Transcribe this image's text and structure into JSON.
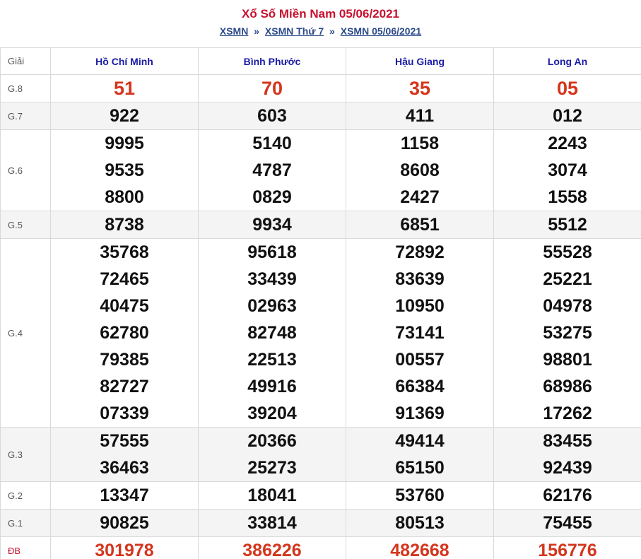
{
  "header": {
    "title": "Xổ Số Miền Nam 05/06/2021",
    "breadcrumb": [
      "XSMN",
      "XSMN Thứ 7",
      "XSMN 05/06/2021"
    ],
    "separator": "»"
  },
  "table": {
    "label_header": "Giải",
    "provinces": [
      "Hồ Chí Minh",
      "Bình Phước",
      "Hậu Giang",
      "Long An"
    ],
    "rows": [
      {
        "label": "G.8",
        "values": [
          [
            "51"
          ],
          [
            "70"
          ],
          [
            "35"
          ],
          [
            "05"
          ]
        ]
      },
      {
        "label": "G.7",
        "values": [
          [
            "922"
          ],
          [
            "603"
          ],
          [
            "411"
          ],
          [
            "012"
          ]
        ]
      },
      {
        "label": "G.6",
        "values": [
          [
            "9995",
            "9535",
            "8800"
          ],
          [
            "5140",
            "4787",
            "0829"
          ],
          [
            "1158",
            "8608",
            "2427"
          ],
          [
            "2243",
            "3074",
            "1558"
          ]
        ]
      },
      {
        "label": "G.5",
        "values": [
          [
            "8738"
          ],
          [
            "9934"
          ],
          [
            "6851"
          ],
          [
            "5512"
          ]
        ]
      },
      {
        "label": "G.4",
        "values": [
          [
            "35768",
            "72465",
            "40475",
            "62780",
            "79385",
            "82727",
            "07339"
          ],
          [
            "95618",
            "33439",
            "02963",
            "82748",
            "22513",
            "49916",
            "39204"
          ],
          [
            "72892",
            "83639",
            "10950",
            "73141",
            "00557",
            "66384",
            "91369"
          ],
          [
            "55528",
            "25221",
            "04978",
            "53275",
            "98801",
            "68986",
            "17262"
          ]
        ]
      },
      {
        "label": "G.3",
        "values": [
          [
            "57555",
            "36463"
          ],
          [
            "20366",
            "25273"
          ],
          [
            "49414",
            "65150"
          ],
          [
            "83455",
            "92439"
          ]
        ]
      },
      {
        "label": "G.2",
        "values": [
          [
            "13347"
          ],
          [
            "18041"
          ],
          [
            "53760"
          ],
          [
            "62176"
          ]
        ]
      },
      {
        "label": "G.1",
        "values": [
          [
            "90825"
          ],
          [
            "33814"
          ],
          [
            "80513"
          ],
          [
            "75455"
          ]
        ]
      },
      {
        "label": "ĐB",
        "values": [
          [
            "301978"
          ],
          [
            "386226"
          ],
          [
            "482668"
          ],
          [
            "156776"
          ]
        ]
      }
    ]
  },
  "colors": {
    "title_red": "#c8102e",
    "highlight_red": "#d4351c",
    "province_blue": "#1a1aa6",
    "link_blue": "#2c4a8a"
  }
}
